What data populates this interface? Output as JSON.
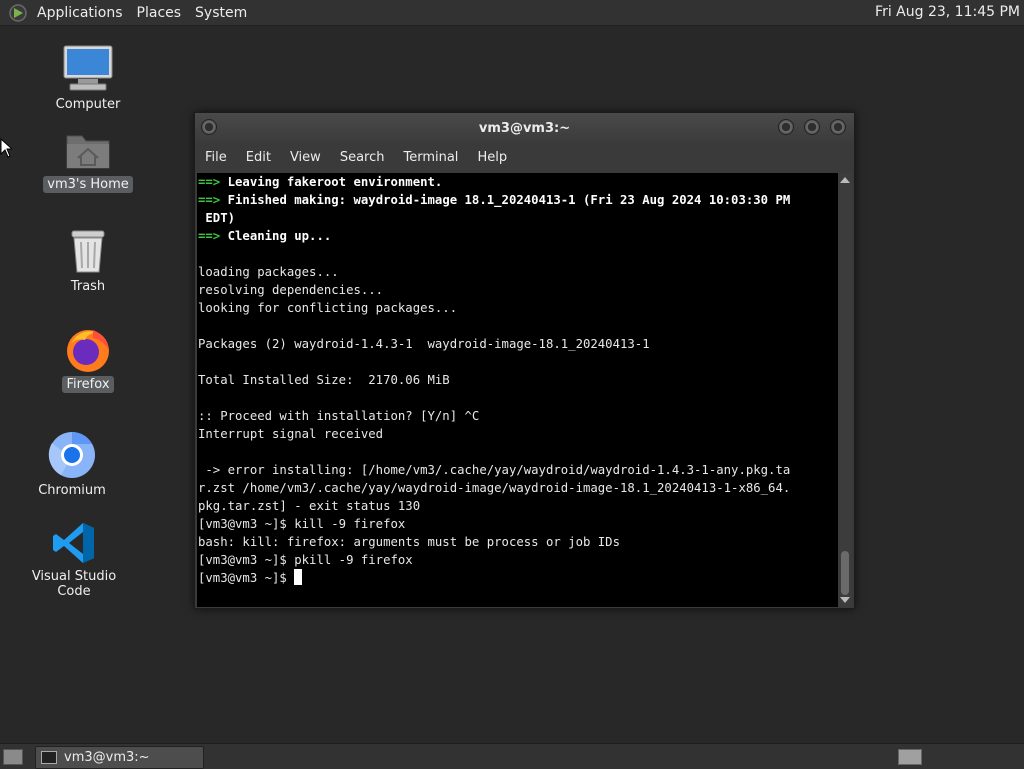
{
  "top_panel": {
    "menus": [
      "Applications",
      "Places",
      "System"
    ],
    "clock": "Fri Aug 23, 11:45 PM"
  },
  "desktop": {
    "icons": [
      {
        "label": "Computer",
        "icon": "computer-icon"
      },
      {
        "label": "vm3's Home",
        "icon": "home-folder-icon"
      },
      {
        "label": "Trash",
        "icon": "trash-icon"
      },
      {
        "label": "Firefox",
        "icon": "firefox-icon"
      },
      {
        "label": "Chromium",
        "icon": "chromium-icon"
      },
      {
        "label": "Visual Studio Code",
        "icon": "vscode-icon"
      }
    ]
  },
  "terminal": {
    "title": "vm3@vm3:~",
    "menu": [
      "File",
      "Edit",
      "View",
      "Search",
      "Terminal",
      "Help"
    ],
    "lines": [
      {
        "prefix": "==>",
        "text": " Leaving fakeroot environment.",
        "style": "bold"
      },
      {
        "prefix": "==>",
        "text": " Finished making: waydroid-image 18.1_20240413-1 (Fri 23 Aug 2024 10:03:30 PM",
        "style": "bold"
      },
      {
        "prefix": "",
        "text": " EDT)",
        "style": "bold"
      },
      {
        "prefix": "==>",
        "text": " Cleaning up...",
        "style": "bold"
      },
      {
        "prefix": "",
        "text": "",
        "style": "plain"
      },
      {
        "prefix": "",
        "text": "loading packages...",
        "style": "plain"
      },
      {
        "prefix": "",
        "text": "resolving dependencies...",
        "style": "plain"
      },
      {
        "prefix": "",
        "text": "looking for conflicting packages...",
        "style": "plain"
      },
      {
        "prefix": "",
        "text": "",
        "style": "plain"
      },
      {
        "prefix": "",
        "text": "Packages (2) waydroid-1.4.3-1  waydroid-image-18.1_20240413-1",
        "style": "plain"
      },
      {
        "prefix": "",
        "text": "",
        "style": "plain"
      },
      {
        "prefix": "",
        "text": "Total Installed Size:  2170.06 MiB",
        "style": "plain"
      },
      {
        "prefix": "",
        "text": "",
        "style": "plain"
      },
      {
        "prefix": "",
        "text": ":: Proceed with installation? [Y/n] ^C",
        "style": "plain"
      },
      {
        "prefix": "",
        "text": "Interrupt signal received",
        "style": "plain"
      },
      {
        "prefix": "",
        "text": "",
        "style": "plain"
      },
      {
        "prefix": "",
        "text": " -> error installing: [/home/vm3/.cache/yay/waydroid/waydroid-1.4.3-1-any.pkg.ta",
        "style": "plain"
      },
      {
        "prefix": "",
        "text": "r.zst /home/vm3/.cache/yay/waydroid-image/waydroid-image-18.1_20240413-1-x86_64.",
        "style": "plain"
      },
      {
        "prefix": "",
        "text": "pkg.tar.zst] - exit status 130",
        "style": "plain"
      },
      {
        "prefix": "",
        "text": "[vm3@vm3 ~]$ kill -9 firefox",
        "style": "plain"
      },
      {
        "prefix": "",
        "text": "bash: kill: firefox: arguments must be process or job IDs",
        "style": "plain"
      },
      {
        "prefix": "",
        "text": "[vm3@vm3 ~]$ pkill -9 firefox",
        "style": "plain"
      }
    ],
    "prompt": "[vm3@vm3 ~]$ "
  },
  "taskbar": {
    "items": [
      {
        "label": "vm3@vm3:~"
      }
    ]
  },
  "colors": {
    "desktop_bg": "#282828",
    "terminal_bg": "#000000",
    "arrow_green": "#3ec43e"
  }
}
